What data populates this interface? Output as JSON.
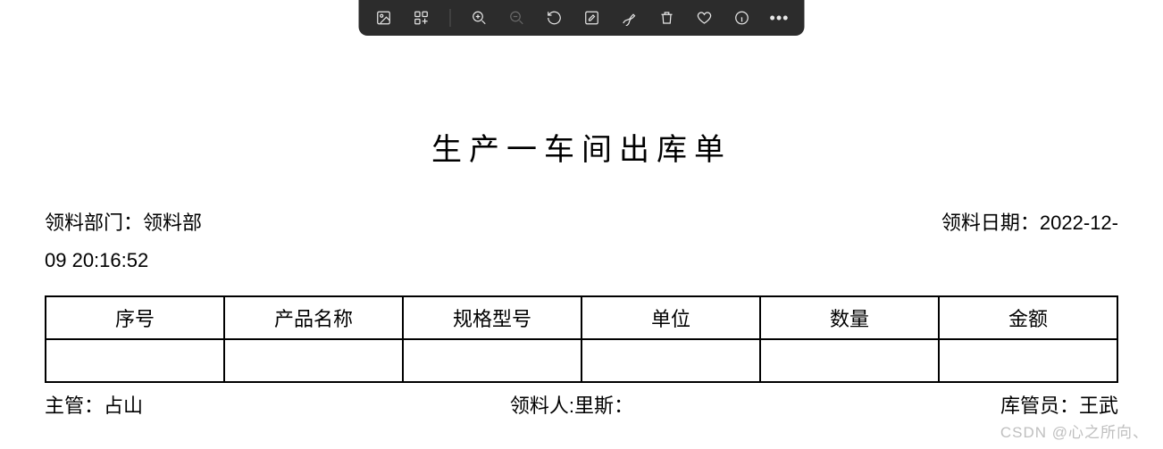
{
  "toolbar": {
    "icons": [
      {
        "name": "image-icon"
      },
      {
        "name": "apps-icon"
      },
      {
        "name": "sep"
      },
      {
        "name": "zoom-in-icon"
      },
      {
        "name": "zoom-out-icon",
        "dim": true
      },
      {
        "name": "rotate-icon"
      },
      {
        "name": "edit-icon"
      },
      {
        "name": "draw-icon"
      },
      {
        "name": "trash-icon"
      },
      {
        "name": "heart-icon"
      },
      {
        "name": "info-icon"
      },
      {
        "name": "more-icon"
      }
    ]
  },
  "document": {
    "title": "生产一车间出库单",
    "dept_label": "领料部门",
    "dept_value": "领料部",
    "date_label": "领料日期",
    "date_value": "2022-12-",
    "date_value_line2": "09 20:16:52",
    "columns": [
      "序号",
      "产品名称",
      "规格型号",
      "单位",
      "数量",
      "金额"
    ],
    "rows": [
      [
        "",
        "",
        "",
        "",
        "",
        ""
      ]
    ],
    "footer": {
      "supervisor_label": "主管",
      "supervisor_value": "占山",
      "picker_label": "领料人",
      "picker_value": "里斯",
      "picker_suffix": "：",
      "keeper_label": "库管员",
      "keeper_value": "王武"
    }
  },
  "watermark": "CSDN @心之所向、"
}
